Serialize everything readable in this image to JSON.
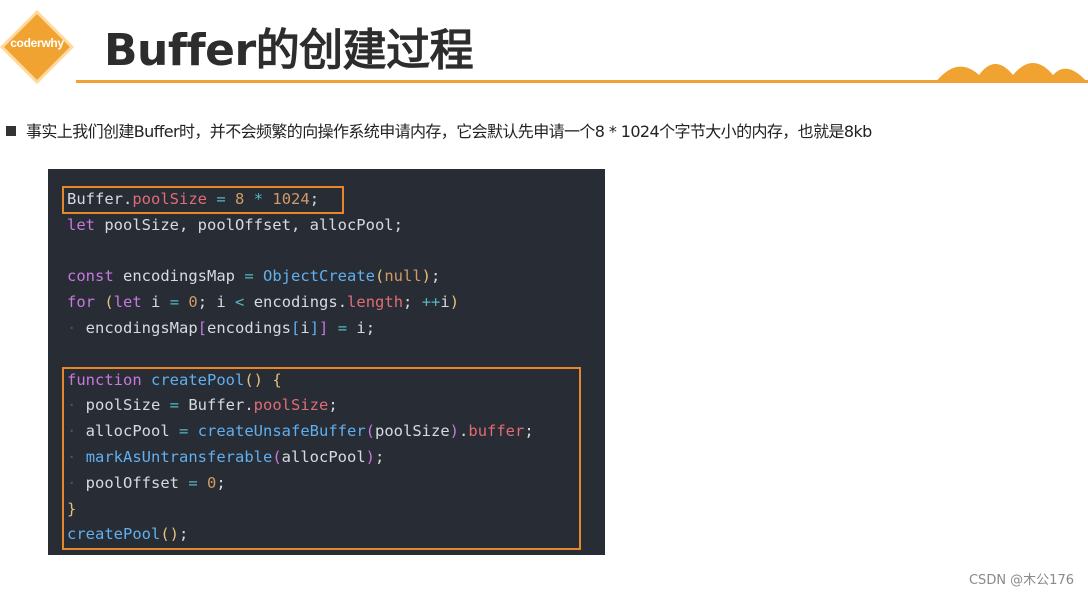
{
  "logo": {
    "text": "coderwhy",
    "color": "#f0a330"
  },
  "slide": {
    "title": "Buffer的创建过程",
    "accent_color": "#f0a330",
    "bullet": "事实上我们创建Buffer时，并不会频繁的向操作系统申请内存，它会默认先申请一个8 * 1024个字节大小的内存，也就是8kb"
  },
  "code": {
    "lines": [
      "Buffer.poolSize = 8 * 1024;",
      "let poolSize, poolOffset, allocPool;",
      "",
      "const encodingsMap = ObjectCreate(null);",
      "for (let i = 0; i < encodings.length; ++i)",
      "  encodingsMap[encodings[i]] = i;",
      "",
      "function createPool() {",
      "  poolSize = Buffer.poolSize;",
      "  allocPool = createUnsafeBuffer(poolSize).buffer;",
      "  markAsUntransferable(allocPool);",
      "  poolOffset = 0;",
      "}",
      "createPool();"
    ],
    "highlight_color": "#e8862a"
  },
  "watermark": "CSDN @木公176"
}
